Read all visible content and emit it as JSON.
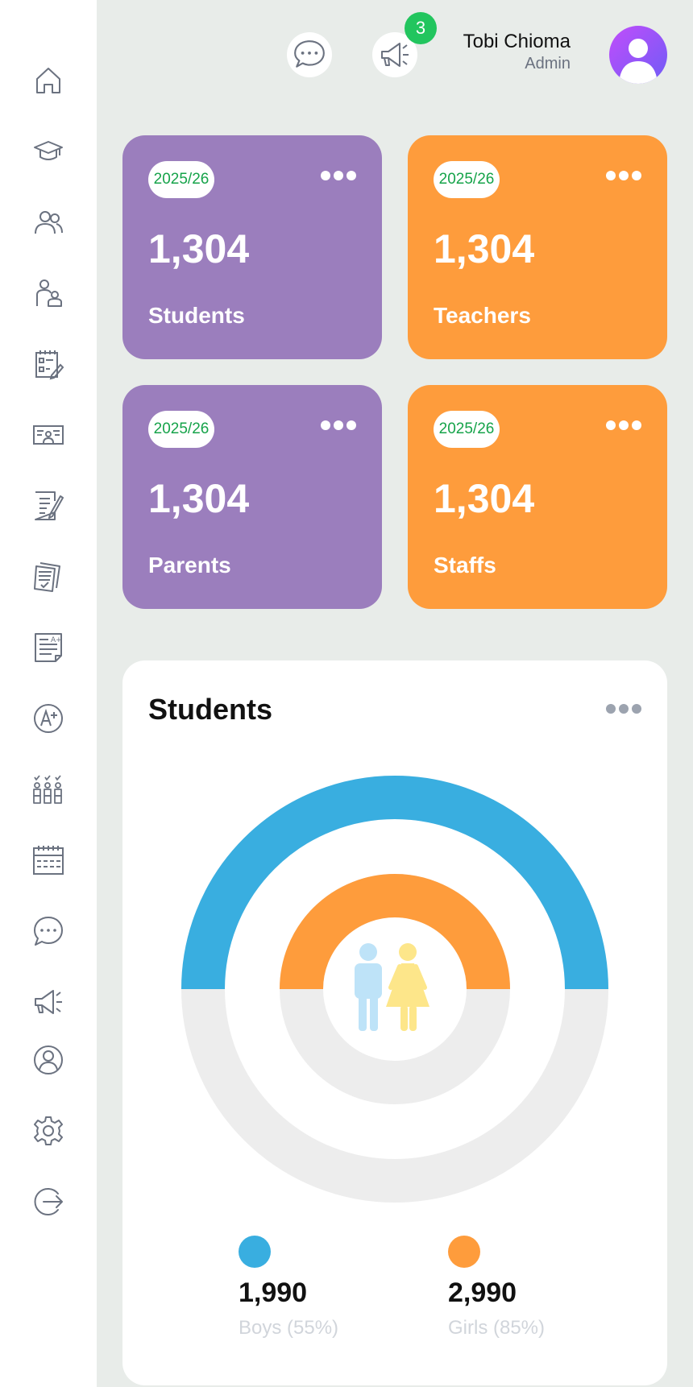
{
  "sidebar": {
    "items": [
      {
        "name": "home",
        "icon": "home-icon"
      },
      {
        "name": "courses",
        "icon": "graduation-cap-icon"
      },
      {
        "name": "students",
        "icon": "users-icon"
      },
      {
        "name": "parents",
        "icon": "parent-child-icon"
      },
      {
        "name": "assignments",
        "icon": "checklist-edit-icon"
      },
      {
        "name": "id-cards",
        "icon": "id-card-icon"
      },
      {
        "name": "notes",
        "icon": "document-edit-icon"
      },
      {
        "name": "exams",
        "icon": "papers-check-icon"
      },
      {
        "name": "report-cards",
        "icon": "grade-document-icon"
      },
      {
        "name": "grades",
        "icon": "grade-circle-icon"
      },
      {
        "name": "attendance",
        "icon": "attendance-group-icon"
      },
      {
        "name": "calendar",
        "icon": "calendar-icon"
      },
      {
        "name": "messages",
        "icon": "chat-icon"
      },
      {
        "name": "announcements",
        "icon": "megaphone-icon"
      },
      {
        "name": "profile",
        "icon": "user-circle-icon"
      },
      {
        "name": "settings",
        "icon": "gear-icon"
      },
      {
        "name": "logout",
        "icon": "logout-icon"
      }
    ]
  },
  "header": {
    "notification_count": "3",
    "user_name": "Tobi Chioma",
    "user_role": "Admin"
  },
  "cards": [
    {
      "year": "2025/26",
      "value": "1,304",
      "label": "Students",
      "color": "#9b7ebd"
    },
    {
      "year": "2025/26",
      "value": "1,304",
      "label": "Teachers",
      "color": "#fe9c3c"
    },
    {
      "year": "2025/26",
      "value": "1,304",
      "label": "Parents",
      "color": "#9b7ebd"
    },
    {
      "year": "2025/26",
      "value": "1,304",
      "label": "Staffs",
      "color": "#fe9c3c"
    }
  ],
  "students_panel": {
    "title": "Students",
    "boys": {
      "value": "1,990",
      "label": "Boys (55%)",
      "color": "#39aee0",
      "fraction": 0.5
    },
    "girls": {
      "value": "2,990",
      "label": "Girls (85%)",
      "color": "#fe9c3c",
      "fraction": 0.5
    }
  },
  "colors": {
    "accent_purple": "#9b7ebd",
    "accent_orange": "#fe9c3c",
    "boys_blue": "#39aee0",
    "track_gray": "#ededed",
    "badge_green": "#22c55e",
    "pill_text_green": "#16a34a"
  }
}
